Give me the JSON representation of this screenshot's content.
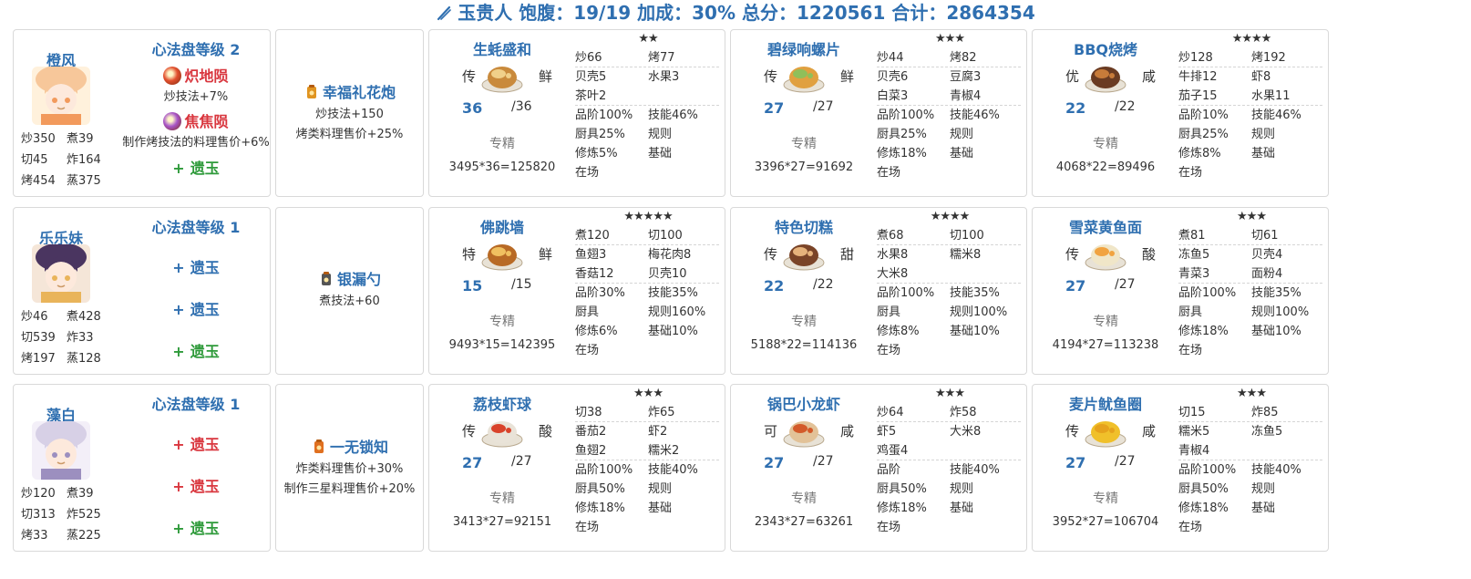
{
  "header": {
    "text": "玉贵人 饱腹：19/19 加成：30% 总分：1220561 合计：2864354"
  },
  "chefs": [
    {
      "name": "橙风",
      "stats": [
        [
          "炒350",
          "煮39"
        ],
        [
          "切45",
          "炸164"
        ],
        [
          "烤454",
          "蒸375"
        ]
      ],
      "xinfa_title": "心法盘等级 2",
      "ambers": [
        {
          "name": "炽地陨",
          "desc": "炒技法+7%",
          "color": "#e2502e"
        },
        {
          "name": "焦焦陨",
          "desc": "制作烤技法的料理售价+6%",
          "color": "#a855c8"
        }
      ],
      "jades": [
        {
          "label": "遗玉",
          "tone": "green"
        }
      ],
      "equip": {
        "name": "幸福礼花炮",
        "desc": [
          "炒技法+150",
          "烤类料理售价+25%"
        ],
        "color": "#e09420"
      },
      "recipes": [
        {
          "name": "生蚝盛和",
          "stars": "★★",
          "rarity": "传",
          "taste": "鲜",
          "qty": "36",
          "max": "/36",
          "skill": "专精",
          "calc": "3495*36=125820",
          "grid": [
            [
              "炒66",
              "烤77"
            ],
            [
              "贝壳5",
              "水果3"
            ],
            [
              "茶叶2",
              ""
            ],
            [
              "品阶100%",
              "技能46%"
            ],
            [
              "厨具25%",
              "规则"
            ],
            [
              "修炼5%",
              "基础"
            ],
            [
              "在场",
              ""
            ]
          ],
          "seps": [
            1,
            3
          ]
        },
        {
          "name": "碧绿响螺片",
          "stars": "★★★",
          "rarity": "传",
          "taste": "鲜",
          "qty": "27",
          "max": "/27",
          "skill": "专精",
          "calc": "3396*27=91692",
          "grid": [
            [
              "炒44",
              "烤82"
            ],
            [
              "贝壳6",
              "豆腐3"
            ],
            [
              "白菜3",
              "青椒4"
            ],
            [
              "品阶100%",
              "技能46%"
            ],
            [
              "厨具25%",
              "规则"
            ],
            [
              "修炼18%",
              "基础"
            ],
            [
              "在场",
              ""
            ]
          ],
          "seps": [
            1,
            3
          ]
        },
        {
          "name": "BBQ烧烤",
          "stars": "★★★★",
          "rarity": "优",
          "taste": "咸",
          "qty": "22",
          "max": "/22",
          "skill": "专精",
          "calc": "4068*22=89496",
          "grid": [
            [
              "炒128",
              "烤192"
            ],
            [
              "牛排12",
              "虾8"
            ],
            [
              "茄子15",
              "水果11"
            ],
            [
              "品阶10%",
              "技能46%"
            ],
            [
              "厨具25%",
              "规则"
            ],
            [
              "修炼8%",
              "基础"
            ],
            [
              "在场",
              ""
            ]
          ],
          "seps": [
            1,
            3
          ]
        }
      ]
    },
    {
      "name": "乐乐妹",
      "stats": [
        [
          "炒46",
          "煮428"
        ],
        [
          "切539",
          "炸33"
        ],
        [
          "烤197",
          "蒸128"
        ]
      ],
      "xinfa_title": "心法盘等级 1",
      "ambers": [],
      "jades": [
        {
          "label": "遗玉",
          "tone": "blue"
        },
        {
          "label": "遗玉",
          "tone": "blue"
        },
        {
          "label": "遗玉",
          "tone": "green"
        }
      ],
      "equip": {
        "name": "银漏勺",
        "desc": [
          "煮技法+60"
        ],
        "color": "#555555"
      },
      "recipes": [
        {
          "name": "佛跳墙",
          "stars": "★★★★★",
          "rarity": "特",
          "taste": "鲜",
          "qty": "15",
          "max": "/15",
          "skill": "专精",
          "calc": "9493*15=142395",
          "grid": [
            [
              "煮120",
              "切100"
            ],
            [
              "鱼翅3",
              "梅花肉8"
            ],
            [
              "香菇12",
              "贝壳10"
            ],
            [
              "品阶30%",
              "技能35%"
            ],
            [
              "厨具",
              "规则160%"
            ],
            [
              "修炼6%",
              "基础10%"
            ],
            [
              "在场",
              ""
            ]
          ],
          "seps": [
            1,
            3
          ]
        },
        {
          "name": "特色切糕",
          "stars": "★★★★",
          "rarity": "传",
          "taste": "甜",
          "qty": "22",
          "max": "/22",
          "skill": "专精",
          "calc": "5188*22=114136",
          "grid": [
            [
              "煮68",
              "切100"
            ],
            [
              "水果8",
              "糯米8"
            ],
            [
              "大米8",
              ""
            ],
            [
              "品阶100%",
              "技能35%"
            ],
            [
              "厨具",
              "规则100%"
            ],
            [
              "修炼8%",
              "基础10%"
            ],
            [
              "在场",
              ""
            ]
          ],
          "seps": [
            1,
            3
          ]
        },
        {
          "name": "雪菜黄鱼面",
          "stars": "★★★",
          "rarity": "传",
          "taste": "酸",
          "qty": "27",
          "max": "/27",
          "skill": "专精",
          "calc": "4194*27=113238",
          "grid": [
            [
              "煮81",
              "切61"
            ],
            [
              "冻鱼5",
              "贝壳4"
            ],
            [
              "青菜3",
              "面粉4"
            ],
            [
              "品阶100%",
              "技能35%"
            ],
            [
              "厨具",
              "规则100%"
            ],
            [
              "修炼18%",
              "基础10%"
            ],
            [
              "在场",
              ""
            ]
          ],
          "seps": [
            1,
            3
          ]
        }
      ]
    },
    {
      "name": "藻白",
      "stats": [
        [
          "炒120",
          "煮39"
        ],
        [
          "切313",
          "炸525"
        ],
        [
          "烤33",
          "蒸225"
        ]
      ],
      "xinfa_title": "心法盘等级 1",
      "ambers": [],
      "jades": [
        {
          "label": "遗玉",
          "tone": "red"
        },
        {
          "label": "遗玉",
          "tone": "red"
        },
        {
          "label": "遗玉",
          "tone": "green"
        }
      ],
      "equip": {
        "name": "一无锁知",
        "desc": [
          "炸类料理售价+30%",
          "制作三星料理售价+20%"
        ],
        "color": "#e07020"
      },
      "recipes": [
        {
          "name": "荔枝虾球",
          "stars": "★★★",
          "rarity": "传",
          "taste": "酸",
          "qty": "27",
          "max": "/27",
          "skill": "专精",
          "calc": "3413*27=92151",
          "grid": [
            [
              "切38",
              "炸65"
            ],
            [
              "番茄2",
              "虾2"
            ],
            [
              "鱼翅2",
              "糯米2"
            ],
            [
              "品阶100%",
              "技能40%"
            ],
            [
              "厨具50%",
              "规则"
            ],
            [
              "修炼18%",
              "基础"
            ],
            [
              "在场",
              ""
            ]
          ],
          "seps": [
            1,
            3
          ]
        },
        {
          "name": "锅巴小龙虾",
          "stars": "★★★",
          "rarity": "可",
          "taste": "咸",
          "qty": "27",
          "max": "/27",
          "skill": "专精",
          "calc": "2343*27=63261",
          "grid": [
            [
              "炒64",
              "炸58"
            ],
            [
              "虾5",
              "大米8"
            ],
            [
              "鸡蛋4",
              ""
            ],
            [
              "品阶",
              "技能40%"
            ],
            [
              "厨具50%",
              "规则"
            ],
            [
              "修炼18%",
              "基础"
            ],
            [
              "在场",
              ""
            ]
          ],
          "seps": [
            1,
            3
          ]
        },
        {
          "name": "麦片鱿鱼圈",
          "stars": "★★★",
          "rarity": "传",
          "taste": "咸",
          "qty": "27",
          "max": "/27",
          "skill": "专精",
          "calc": "3952*27=106704",
          "grid": [
            [
              "切15",
              "炸85"
            ],
            [
              "糯米5",
              "冻鱼5"
            ],
            [
              "青椒4",
              ""
            ],
            [
              "品阶100%",
              "技能40%"
            ],
            [
              "厨具50%",
              "规则"
            ],
            [
              "修炼18%",
              "基础"
            ],
            [
              "在场",
              ""
            ]
          ],
          "seps": [
            1,
            3
          ]
        }
      ]
    }
  ]
}
